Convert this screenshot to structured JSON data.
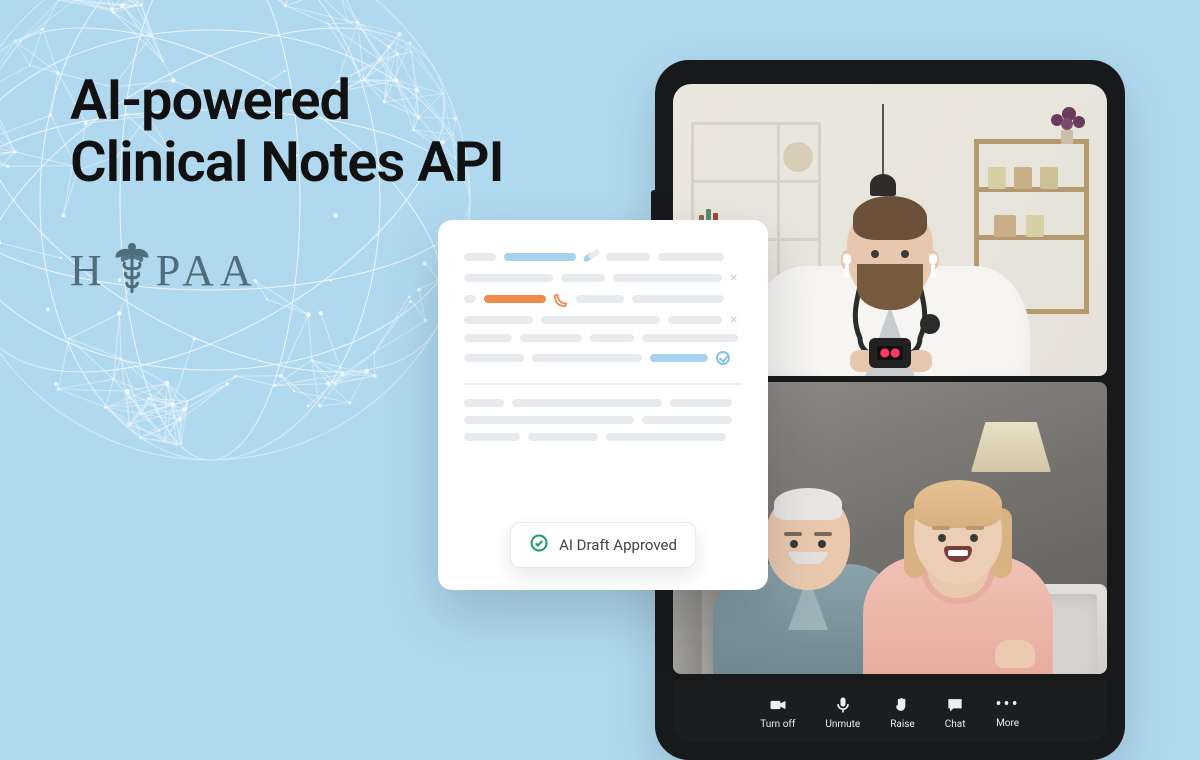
{
  "headline": {
    "line1": "AI-powered",
    "line2": "Clinical Notes API"
  },
  "hipaa": {
    "left": "H",
    "right": "PAA"
  },
  "card": {
    "chip_label": "AI Draft Approved"
  },
  "toolbar": {
    "items": [
      {
        "id": "turn-off",
        "label": "Turn off"
      },
      {
        "id": "unmute",
        "label": "Unmute"
      },
      {
        "id": "raise",
        "label": "Raise"
      },
      {
        "id": "chat",
        "label": "Chat"
      },
      {
        "id": "more",
        "label": "More"
      }
    ]
  }
}
